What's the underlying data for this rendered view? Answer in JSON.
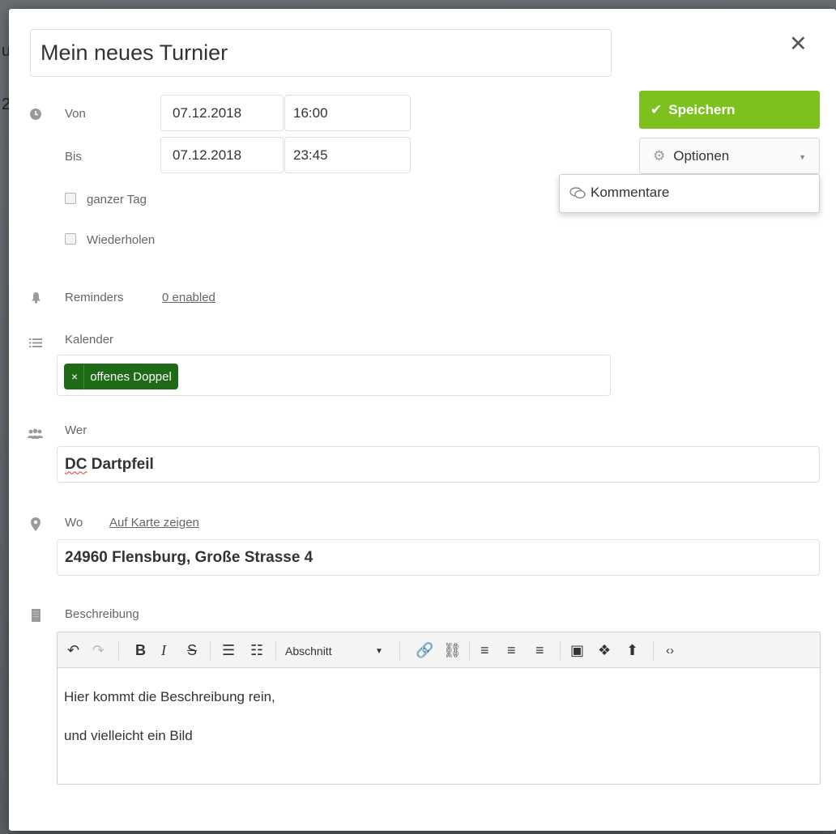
{
  "background": {
    "peek_top": "u",
    "peek_mid": "2"
  },
  "title": "Mein neues Turnier",
  "close_glyph": "✕",
  "from": {
    "label": "Von",
    "date": "07.12.2018",
    "time": "16:00"
  },
  "to": {
    "label": "Bis",
    "date": "07.12.2018",
    "time": "23:45"
  },
  "all_day_label": "ganzer Tag",
  "repeat_label": "Wiederholen",
  "reminders": {
    "label": "Reminders",
    "link": "0 enabled"
  },
  "calendar": {
    "label": "Kalender",
    "tag_remove": "×",
    "tag": "offenes Doppel"
  },
  "who": {
    "label": "Wer",
    "value_a": "DC",
    "value_b": " Dartpfeil"
  },
  "where": {
    "label": "Wo",
    "link": "Auf Karte zeigen",
    "value": "24960 Flensburg, Große Strasse 4"
  },
  "description": {
    "label": "Beschreibung",
    "format_select": "Abschnitt",
    "lines": [
      "Hier kommt die Beschreibung rein,",
      "und vielleicht ein Bild"
    ]
  },
  "buttons": {
    "save": "Speichern",
    "options": "Optionen",
    "comments": "Kommentare"
  },
  "colors": {
    "save_bg": "#7dc11e",
    "tag_bg": "#1e6a16"
  }
}
